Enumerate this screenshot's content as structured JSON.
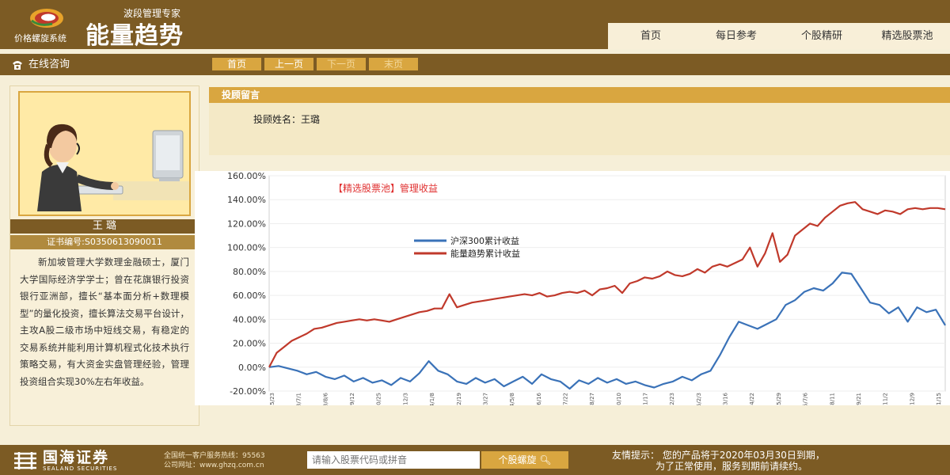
{
  "header": {
    "logo_slogan": "波段管理专家",
    "logo_title": "能量趋势",
    "logo_sub": "价格螺旋系统",
    "nav": [
      "首页",
      "每日参考",
      "个股精研",
      "精选股票池"
    ]
  },
  "toolbar": {
    "consult_label": "在线咨询",
    "pager": [
      {
        "label": "首页",
        "enabled": true
      },
      {
        "label": "上一页",
        "enabled": true
      },
      {
        "label": "下一页",
        "enabled": false
      },
      {
        "label": "末页",
        "enabled": false
      }
    ]
  },
  "profile": {
    "name": "王 璐",
    "cert": "证书编号:S0350613090011",
    "bio": "新加坡管理大学数理金融硕士，厦门大学国际经济学学士；曾在花旗银行投资银行亚洲部，擅长“基本面分析+数理模型”的量化投资，擅长算法交易平台设计，主攻A股二级市场中短线交易，有稳定的交易系统并能利用计算机程式化技术执行策略交易，有大资金实盘管理经验，管理投资组合实现30%左右年收益。"
  },
  "message": {
    "header": "投顾留言",
    "name_line": "投顾姓名：王璐"
  },
  "chart_data": {
    "type": "line",
    "title": "【精选股票池】管理收益",
    "ylim": [
      -20,
      160
    ],
    "yticks": [
      "-20.00%",
      "0.00%",
      "20.00%",
      "40.00%",
      "60.00%",
      "80.00%",
      "100.00%",
      "120.00%",
      "140.00%",
      "160.00%"
    ],
    "x_dates": [
      "2013/5/23",
      "2013/7/1",
      "2013/8/6",
      "2013/9/12",
      "2013/10/25",
      "2013/12/3",
      "2014/1/8",
      "2014/2/19",
      "2014/3/27",
      "2014/5/8",
      "2014/6/16",
      "2014/7/22",
      "2014/8/27",
      "2014/10/10",
      "2014/11/17",
      "2014/12/23",
      "2015/2/3",
      "2015/3/16",
      "2015/4/22",
      "2015/5/29",
      "2015/7/6",
      "2015/8/11",
      "2015/9/21",
      "2015/11/2",
      "2015/12/9",
      "2016/1/15"
    ],
    "series": [
      {
        "name": "沪深300累计收益",
        "color": "#3a72b8",
        "values": [
          0,
          1,
          -1,
          -3,
          -6,
          -4,
          -8,
          -10,
          -7,
          -12,
          -9,
          -13,
          -11,
          -15,
          -9,
          -12,
          -5,
          5,
          -3,
          -6,
          -12,
          -14,
          -9,
          -13,
          -10,
          -16,
          -12,
          -8,
          -14,
          -6,
          -10,
          -12,
          -18,
          -11,
          -14,
          -9,
          -13,
          -10,
          -14,
          -12,
          -15,
          -17,
          -14,
          -12,
          -8,
          -11,
          -6,
          -3,
          10,
          25,
          38,
          35,
          32,
          36,
          40,
          52,
          56,
          63,
          66,
          64,
          70,
          79,
          78,
          66,
          54,
          52,
          45,
          50,
          38,
          50,
          46,
          48,
          35
        ]
      },
      {
        "name": "能量趋势累计收益",
        "color": "#c0392b",
        "values": [
          0,
          12,
          17,
          22,
          25,
          28,
          32,
          33,
          35,
          37,
          38,
          39,
          40,
          39,
          40,
          39,
          38,
          40,
          42,
          44,
          46,
          47,
          49,
          49,
          61,
          50,
          52,
          54,
          55,
          56,
          57,
          58,
          59,
          60,
          61,
          60,
          62,
          59,
          60,
          62,
          63,
          62,
          64,
          60,
          65,
          66,
          68,
          62,
          70,
          72,
          75,
          74,
          76,
          80,
          77,
          76,
          78,
          82,
          79,
          84,
          86,
          84,
          87,
          90,
          100,
          84,
          95,
          112,
          88,
          94,
          110,
          115,
          120,
          118,
          125,
          130,
          135,
          137,
          138,
          132,
          130,
          128,
          131,
          130,
          128,
          132,
          133,
          132,
          133,
          133,
          132
        ]
      }
    ]
  },
  "footer": {
    "brand_cn": "国海证券",
    "brand_en": "SEALAND SECURITIES",
    "hotline": "全国统一客户服务热线：95563",
    "website": "公司网址：www.ghzq.com.cn",
    "search_placeholder": "请输入股票代码或拼音",
    "search_button": "个股螺旋",
    "notice_line1": "友情提示：  您的产品将于2020年03月30日到期，",
    "notice_line2": "为了正常使用，服务到期前请续约。"
  }
}
